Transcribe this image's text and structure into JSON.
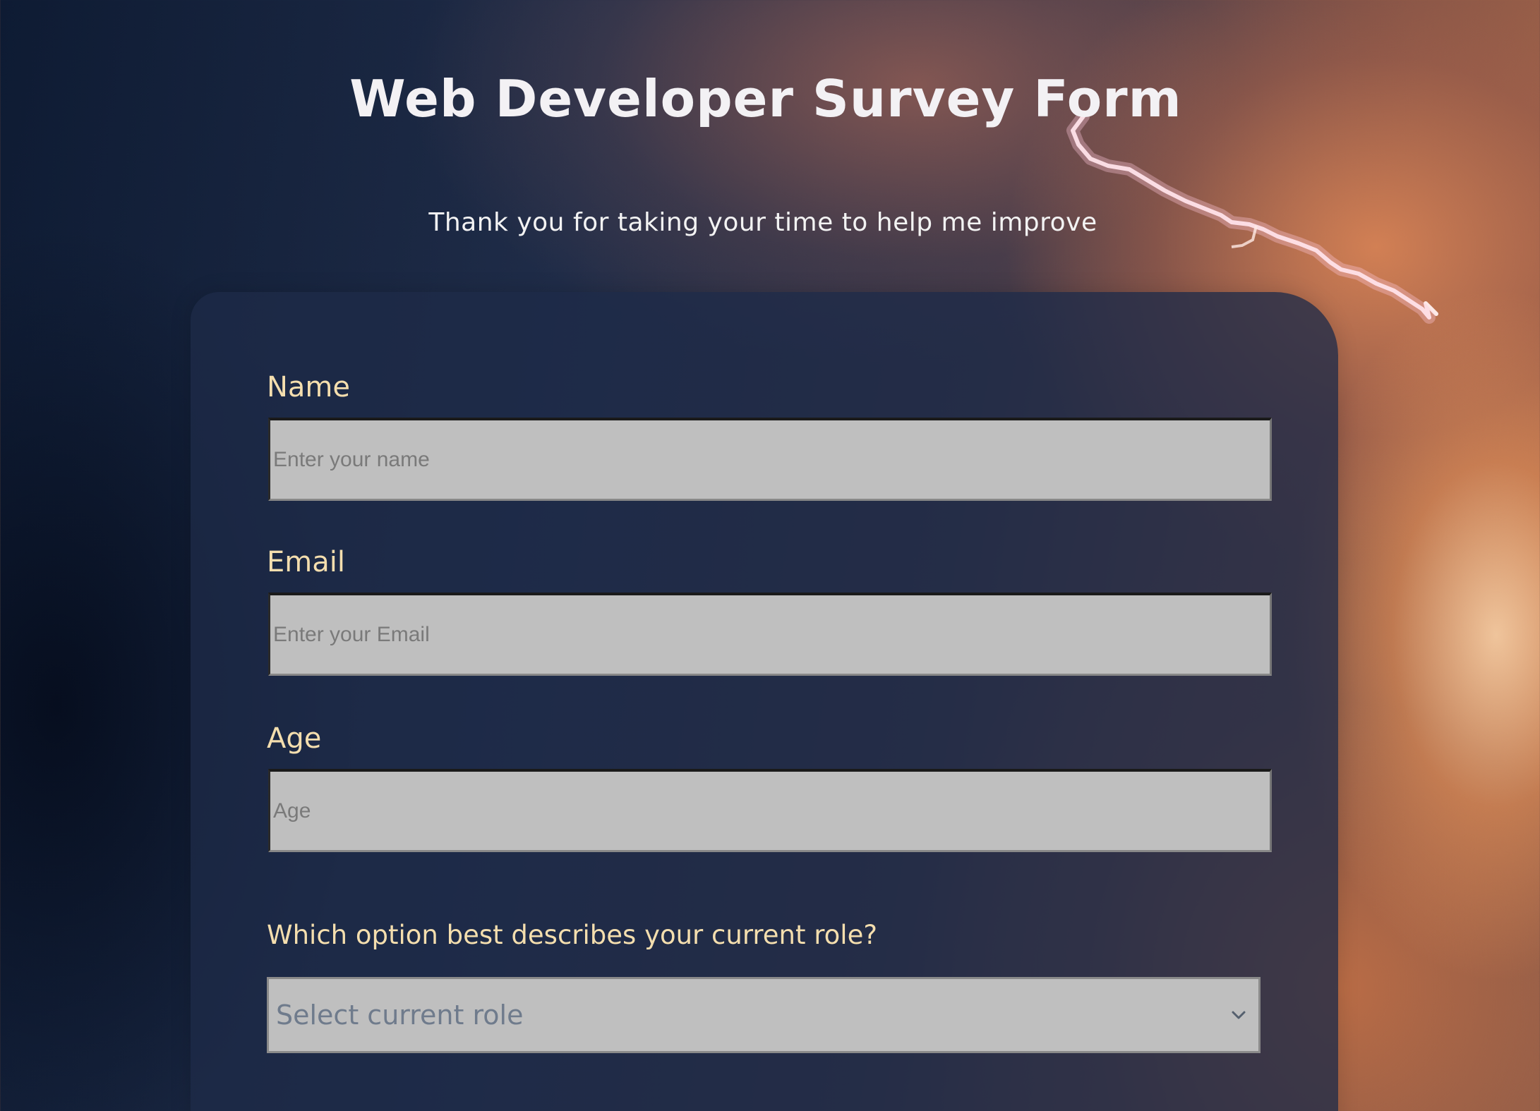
{
  "header": {
    "title": "Web Developer Survey Form",
    "description": "Thank you for taking your time to help me improve"
  },
  "form": {
    "name": {
      "label": "Name",
      "placeholder": "Enter your name",
      "value": ""
    },
    "email": {
      "label": "Email",
      "placeholder": "Enter your Email",
      "value": ""
    },
    "age": {
      "label": "Age",
      "placeholder": "Age",
      "value": ""
    },
    "role": {
      "question": "Which option best describes your current role?",
      "selected": "Select current role",
      "icon": "chevron-down-icon"
    }
  },
  "colors": {
    "label": "#f4deae",
    "card": "#1d2a48",
    "input": "#bfbfbf"
  }
}
